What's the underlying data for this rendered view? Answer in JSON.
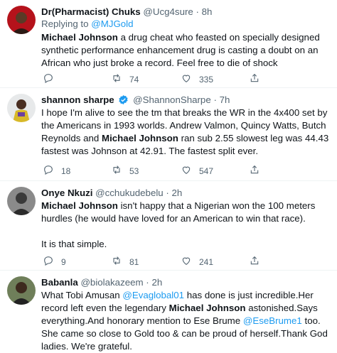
{
  "tweets": [
    {
      "name": "Dr(Pharmacist) Chuks",
      "handle": "@Ucg4sure",
      "time": "8h",
      "dot": "·",
      "replying_prefix": "Replying to ",
      "replying_handle": "@MJGold",
      "text_bold": "Michael Johnson",
      "text_rest": " a drug cheat who feasted on specially designed synthetic performance enhancement drug is casting a doubt on an African who just broke a record. Feel free to die of shock",
      "replies": "",
      "retweets": "74",
      "likes": "335"
    },
    {
      "name": "shannon sharpe",
      "handle": "@ShannonSharpe",
      "time": "7h",
      "dot": "·",
      "verified": true,
      "text_pre": "I hope I'm alive to see the tm that breaks the WR in the 4x400 set by the Americans in 1993 worlds. Andrew Valmon, Quincy Watts, Butch Reynolds and ",
      "text_bold": "Michael Johnson",
      "text_post": " ran sub 2.55 slowest leg was 44.43 fastest was Johnson at 42.91. The fastest split ever.",
      "replies": "18",
      "retweets": "53",
      "likes": "547"
    },
    {
      "name": "Onye Nkuzi",
      "handle": "@cchukudebelu",
      "time": "2h",
      "dot": "·",
      "text_bold": "Michael Johnson",
      "text_rest": " isn't happy that a Nigerian won the 100 meters hurdles (he would have loved for an American to win that race).",
      "text_extra": "It is that simple.",
      "replies": "9",
      "retweets": "81",
      "likes": "241"
    },
    {
      "name": "Babanla",
      "handle": "@biolakazeem",
      "time": "2h",
      "dot": "·",
      "text_a": "What Tobi Amusan ",
      "mention_a": "@Evaglobal01",
      "text_b": " has done is just incredible.Her record left even the legendary ",
      "text_bold": "Michael Johnson",
      "text_c": " astonished.Says everything.And honorary mention to Ese Brume ",
      "mention_b": "@EseBrume1",
      "text_d": " too. She came so close to Gold too & can be proud of herself.Thank God ladies. We're grateful."
    }
  ],
  "colors": {
    "accent": "#1d9bf0",
    "secondary_text": "#536471",
    "divider": "#eff3f4"
  },
  "icons": [
    "reply-icon",
    "retweet-icon",
    "like-icon",
    "share-icon",
    "verified-badge-icon"
  ]
}
